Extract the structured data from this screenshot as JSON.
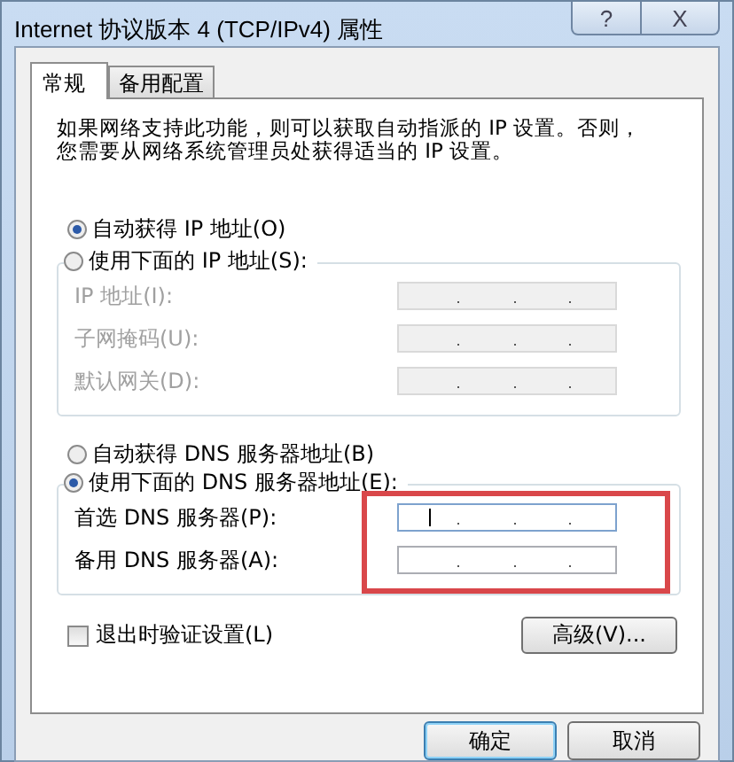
{
  "window": {
    "title": "Internet 协议版本 4 (TCP/IPv4) 属性",
    "help_button": "?",
    "close_button": "X"
  },
  "tabs": [
    {
      "label": "常规",
      "selected": true
    },
    {
      "label": "备用配置",
      "selected": false
    }
  ],
  "description": "如果网络支持此功能，则可以获取自动指派的 IP 设置。否则，您需要从网络系统管理员处获得适当的 IP 设置。",
  "ip_options": [
    {
      "label": "自动获得 IP 地址(O)",
      "selected": true
    },
    {
      "label": "使用下面的 IP 地址(S):",
      "selected": false
    }
  ],
  "ip_fields": [
    {
      "label": "IP 地址(I):",
      "disabled": true,
      "focused": false
    },
    {
      "label": "子网掩码(U):",
      "disabled": true,
      "focused": false
    },
    {
      "label": "默认网关(D):",
      "disabled": true,
      "focused": false
    }
  ],
  "dns_options": [
    {
      "label": "自动获得 DNS 服务器地址(B)",
      "selected": false
    },
    {
      "label": "使用下面的 DNS 服务器地址(E):",
      "selected": true
    }
  ],
  "dns_fields": [
    {
      "label": "首选 DNS 服务器(P):",
      "disabled": false,
      "focused": true
    },
    {
      "label": "备用 DNS 服务器(A):",
      "disabled": false,
      "focused": false
    }
  ],
  "validate_checkbox": {
    "label": "退出时验证设置(L)",
    "checked": false
  },
  "advanced_button": "高级(V)...",
  "buttons": [
    "确定",
    "取消"
  ]
}
